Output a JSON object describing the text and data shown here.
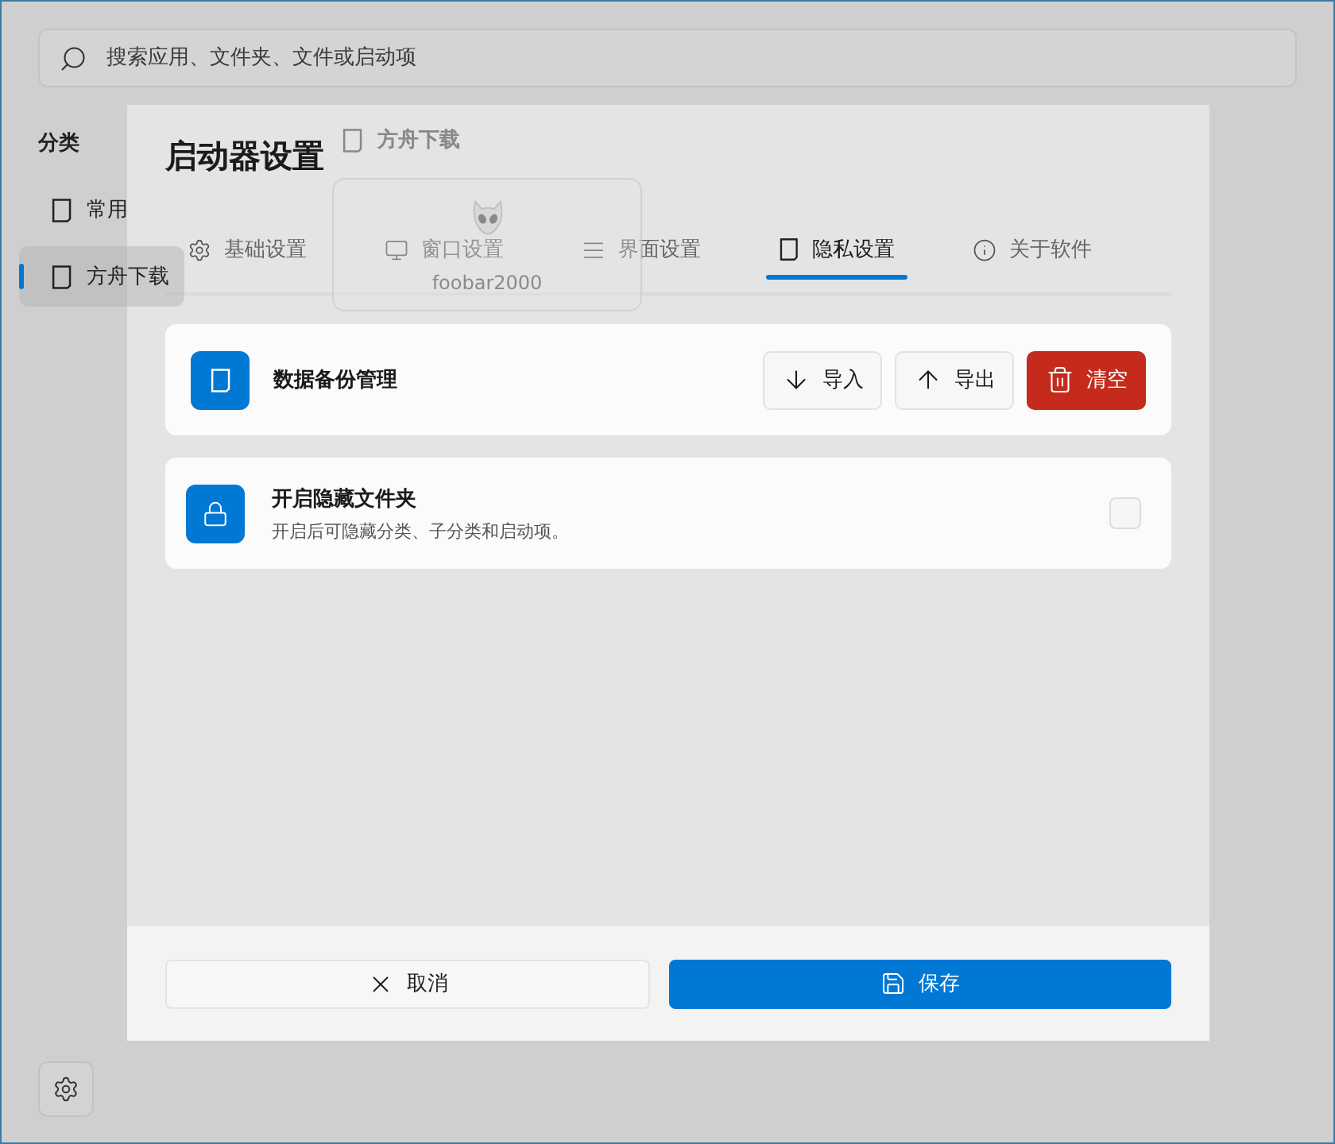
{
  "search": {
    "placeholder": "搜索应用、文件夹、文件或启动项"
  },
  "sidebar": {
    "heading": "分类",
    "items": [
      {
        "label": "常用",
        "selected": false
      },
      {
        "label": "方舟下载",
        "selected": true
      }
    ]
  },
  "drag_preview": {
    "category": "方舟下载",
    "app": "foobar2000"
  },
  "dialog": {
    "title": "启动器设置",
    "tabs": [
      {
        "label": "基础设置",
        "selected": false
      },
      {
        "label": "窗口设置",
        "selected": false
      },
      {
        "label": "界面设置",
        "selected": false
      },
      {
        "label": "隐私设置",
        "selected": true
      },
      {
        "label": "关于软件",
        "selected": false
      }
    ],
    "cards": [
      {
        "kind": "actions",
        "title": "数据备份管理",
        "buttons": [
          {
            "label": "导入",
            "kind": "import"
          },
          {
            "label": "导出",
            "kind": "export"
          },
          {
            "label": "清空",
            "kind": "clear"
          }
        ]
      },
      {
        "kind": "toggle",
        "title": "开启隐藏文件夹",
        "description": "开启后可隐藏分类、子分类和启动项。",
        "checked": false
      }
    ],
    "footer": [
      {
        "label": "取消",
        "kind": "cancel"
      },
      {
        "label": "保存",
        "kind": "save"
      }
    ]
  }
}
